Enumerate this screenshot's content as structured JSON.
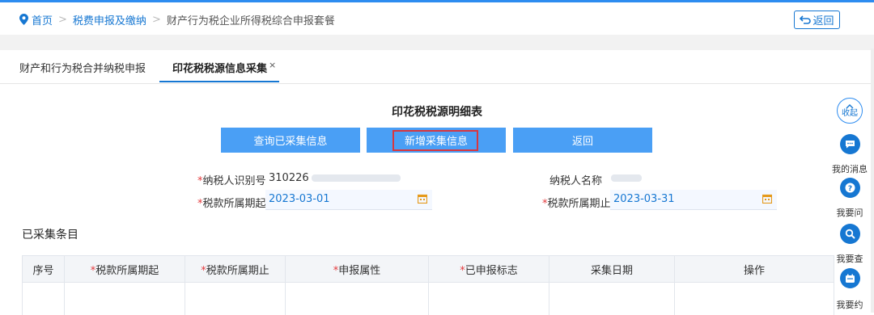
{
  "breadcrumb": {
    "home": "首页",
    "level2": "税费申报及缴纳",
    "current": "财产行为税企业所得税综合申报套餐"
  },
  "back_top_label": "返回",
  "tabs": [
    {
      "label": "财产和行为税合并纳税申报"
    },
    {
      "label": "印花税税源信息采集",
      "close": "×"
    }
  ],
  "page_title": "印花税税源明细表",
  "buttons": {
    "query": "查询已采集信息",
    "add": "新增采集信息",
    "back": "返回"
  },
  "form": {
    "taxpayer_id_label": "纳税人识别号",
    "taxpayer_id_value": "310226",
    "taxpayer_name_label": "纳税人名称",
    "period_start_label": "税款所属期起",
    "period_start_value": "2023-03-01",
    "period_end_label": "税款所属期止",
    "period_end_value": "2023-03-31",
    "required_mark": "*"
  },
  "section_title": "已采集条目",
  "table": {
    "headers": [
      "序号",
      "*税款所属期起",
      "*税款所属期止",
      "*申报属性",
      "*已申报标志",
      "采集日期",
      "操作"
    ]
  },
  "sidebar": {
    "collapse_label": "收起",
    "items": [
      {
        "label": "我的消息",
        "icon": "message-icon"
      },
      {
        "label": "我要问",
        "icon": "question-icon"
      },
      {
        "label": "我要查",
        "icon": "search-icon"
      },
      {
        "label": "我要约",
        "icon": "calendar-icon"
      }
    ]
  },
  "colors": {
    "accent": "#1677d2",
    "button": "#4a9ff5",
    "highlight": "#d9363e"
  }
}
